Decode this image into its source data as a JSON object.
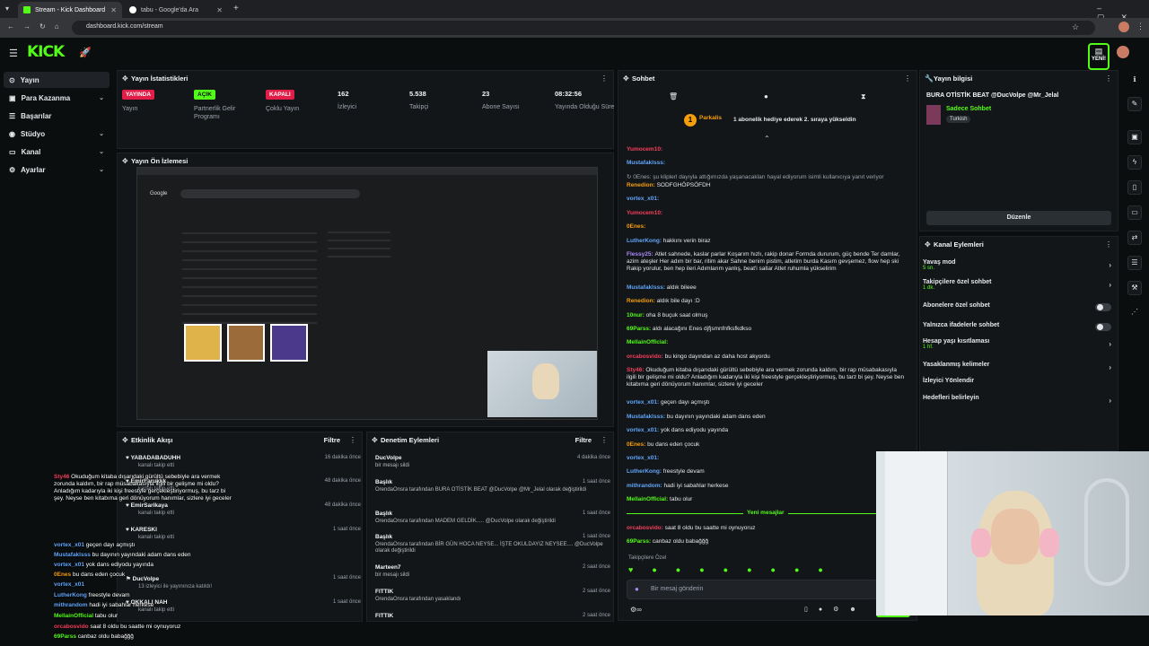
{
  "browser": {
    "tabs": [
      {
        "title": "Stream - Kick Dashboard"
      },
      {
        "title": "tabu - Google'da Ara"
      }
    ],
    "url": "dashboard.kick.com/stream"
  },
  "header": {
    "logo": "KICK",
    "new_badge": "YENİ!"
  },
  "sidebar": {
    "items": [
      {
        "label": "Yayın"
      },
      {
        "label": "Para Kazanma"
      },
      {
        "label": "Başarılar"
      },
      {
        "label": "Stüdyo"
      },
      {
        "label": "Kanal"
      },
      {
        "label": "Ayarlar"
      }
    ]
  },
  "stats": {
    "title": "Yayın İstatistikleri",
    "items": [
      {
        "value": "YAYINDA",
        "label": "Yayın"
      },
      {
        "value": "AÇIK",
        "label": "Partnerlik Gelir Programı"
      },
      {
        "value": "KAPALI",
        "label": "Çoklu Yayın"
      },
      {
        "value": "162",
        "label": "İzleyici"
      },
      {
        "value": "5.538",
        "label": "Takipçi"
      },
      {
        "value": "23",
        "label": "Abone Sayısı"
      },
      {
        "value": "08:32:56",
        "label": "Yayında Olduğu Süre"
      }
    ]
  },
  "preview": {
    "title": "Yayın Ön İzlemesi"
  },
  "activity": {
    "title": "Etkinlik Akışı",
    "filter": "Filtre",
    "rows": [
      {
        "name": "YABADABADUHH",
        "sub": "kanalı takip etti",
        "time": "16 dakika önce"
      },
      {
        "name": "EmirFarukkk",
        "sub": "kanalı takip etti",
        "time": "48 dakika önce"
      },
      {
        "name": "EmirSarikaya",
        "sub": "kanalı takip etti",
        "time": "48 dakika önce"
      },
      {
        "name": "KARESKI",
        "sub": "kanalı takip etti",
        "time": "1 saat önce"
      },
      {
        "name": "DucVolpe",
        "sub": "13 izleyici ile yayınınıza katıldı!",
        "time": "1 saat önce"
      },
      {
        "name": "OKKALI NAH",
        "sub": "kanalı takip etti",
        "time": "1 saat önce"
      }
    ]
  },
  "moderation": {
    "title": "Denetim Eylemleri",
    "filter": "Filtre",
    "rows": [
      {
        "name": "DucVolpe",
        "sub": "bir mesajı sildi",
        "time": "4 dakika önce"
      },
      {
        "name": "Başlık",
        "sub": "OrendaOnsra tarafından BURA OTİSTİK BEAT @DucVolpe @Mr_Jelal olarak değiştirildi",
        "time": "1 saat önce"
      },
      {
        "name": "Başlık",
        "sub": "OrendaOnsra tarafından MADEM GELDİK..... @DucVolpe olarak değiştirildi",
        "time": "1 saat önce"
      },
      {
        "name": "Başlık",
        "sub": "OrendaOnsra tarafından BİR GÜN HOCA NEYSE... İŞTE OKULDAYIZ NEYSEE.... @DucVolpe olarak değiştirildi",
        "time": "1 saat önce"
      },
      {
        "name": "Marteen7",
        "sub": "bir mesajı sildi",
        "time": "2 saat önce"
      },
      {
        "name": "FITTIK",
        "sub": "OrendaOnsra tarafından yasaklandı",
        "time": "2 saat önce"
      },
      {
        "name": "FITTIK",
        "sub": "",
        "time": "2 saat önce"
      }
    ]
  },
  "chat": {
    "title": "Sohbet",
    "pinned_user": "Parkalis",
    "pinned_text": "1 abonelik hediye ederek 2. sıraya yükseldin",
    "new_messages": "Yeni mesajlar",
    "followers_only": "Takipçilere Özel",
    "input_placeholder": "Bir mesaj gönderin",
    "messages": [
      {
        "user": "Yumocem10",
        "color": "#f43f5e",
        "text": ""
      },
      {
        "user": "Mustafaklsss",
        "color": "#60a5fa",
        "text": ""
      },
      {
        "user": "",
        "color": "#9ca3af",
        "text": "↻ 0Enes: şu kliplerl dayıyla attığımızda yaşanacakları hayal ediyorum isimli kullanıcıya yanıt veriyor"
      },
      {
        "user": "Renedion",
        "color": "#f59e0b",
        "text": "SODFGHÖPSÖFDH"
      },
      {
        "user": "vortex_x01",
        "color": "#60a5fa",
        "text": ""
      },
      {
        "user": "Yumocem10",
        "color": "#f43f5e",
        "text": ""
      },
      {
        "user": "0Enes",
        "color": "#f59e0b",
        "text": ""
      },
      {
        "user": "LutherKong",
        "color": "#60a5fa",
        "text": "hakkını verin biraz"
      },
      {
        "user": "Flessy25",
        "color": "#a78bfa",
        "text": "Atlet sahnede, kaslar parlar Koşarım hızlı, rakip donar Formda dururum, güç bende Ter damlar, azim ateşler Her adım bir bar, ritim akar Sahne benim pistim, atletim burda Kasım gevşemez, flow hep ski Rakip yorulur, ben hep ileri Adımlarım yanlış, beat'i sallar Atlet ruhumla yükselirim"
      },
      {
        "user": "Mustafaklsss",
        "color": "#60a5fa",
        "text": "aldık bileee"
      },
      {
        "user": "Renedion",
        "color": "#f59e0b",
        "text": "aldık bile dayı :D"
      },
      {
        "user": "10nur",
        "color": "#53fc18",
        "text": "oha 8 buçuk saat olmuş"
      },
      {
        "user": "69Parss",
        "color": "#53fc18",
        "text": "aldı alacağını Enes djfjsmnfnfksfkdkso"
      },
      {
        "user": "MellainOfficial",
        "color": "#53fc18",
        "text": ""
      },
      {
        "user": "orcabosvido",
        "color": "#f43f5e",
        "text": "bu kingo dayından az daha host akyordu"
      },
      {
        "user": "Sty46",
        "color": "#f43f5e",
        "text": "Okuduğum kitaba dışarıdaki gürültü sebebiyle ara vermek zorunda kaldım, bir rap müsabakasıyla ilgili bir gelişme mi oldu? Anladığım kadarıyla iki kişi freestyle gerçekleştiriyormuş, bu tarz bi şey. Neyse ben kitabıma geri dönüyorum hanımlar, sizlere iyi geceler"
      },
      {
        "user": "vortex_x01",
        "color": "#60a5fa",
        "text": "geçen dayı açmıştı"
      },
      {
        "user": "Mustafaklsss",
        "color": "#60a5fa",
        "text": "bu dayının yayındaki adam dans eden"
      },
      {
        "user": "vortex_x01",
        "color": "#60a5fa",
        "text": "yok dans ediyodu yayında"
      },
      {
        "user": "0Enes",
        "color": "#f59e0b",
        "text": "bu dans eden çocuk"
      },
      {
        "user": "vortex_x01",
        "color": "#60a5fa",
        "text": ""
      },
      {
        "user": "LutherKong",
        "color": "#60a5fa",
        "text": "freestyle devam"
      },
      {
        "user": "mithrandom",
        "color": "#60a5fa",
        "text": "hadi iyi sabahlar herkese"
      },
      {
        "user": "MellainOfficial",
        "color": "#53fc18",
        "text": "tabu olur"
      },
      {
        "user": "orcabosvido",
        "color": "#f43f5e",
        "text": "saat 8 oldu bu saatte mi oynuyoruz"
      },
      {
        "user": "69Parss",
        "color": "#53fc18",
        "text": "canbaz oldu babağğğ"
      }
    ]
  },
  "stream_info": {
    "title": "Yayın bilgisi",
    "stream_title": "BURA OTİSTİK BEAT @DucVolpe @Mr_Jelal",
    "category": "Sadece Sohbet",
    "tag": "Turkish",
    "edit_button": "Düzenle"
  },
  "channel_actions": {
    "title": "Kanal Eylemleri",
    "items": [
      {
        "label": "Yavaş mod",
        "sub": "5 sn.",
        "type": "chevron"
      },
      {
        "label": "Takipçilere özel sohbet",
        "sub": "1 dk.",
        "type": "chevron"
      },
      {
        "label": "Abonelere özel sohbet",
        "sub": "",
        "type": "toggle"
      },
      {
        "label": "Yalnızca ifadelerle sohbet",
        "sub": "",
        "type": "toggle"
      },
      {
        "label": "Hesap yaşı kısıtlaması",
        "sub": "1 hf.",
        "type": "chevron"
      },
      {
        "label": "Yasaklanmış kelimeler",
        "sub": "",
        "type": "chevron"
      },
      {
        "label": "İzleyici Yönlendir",
        "sub": "",
        "type": "none"
      },
      {
        "label": "Hedefleri belirleyin",
        "sub": "",
        "type": "chevron"
      }
    ]
  },
  "colors": {
    "accent": "#53fc18",
    "live": "#e11d48",
    "bg": "#0b0e0f",
    "panel": "#131618"
  }
}
